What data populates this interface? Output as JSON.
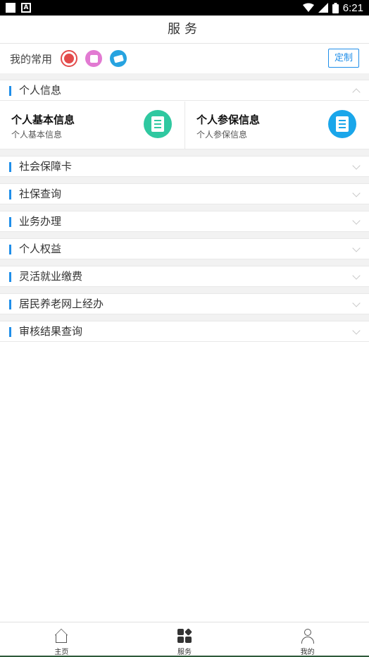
{
  "status_bar": {
    "time": "6:21",
    "a_icon": "A"
  },
  "header": {
    "title": "服务"
  },
  "favorites": {
    "label": "我的常用",
    "icons": [
      "social-security-logo-icon",
      "document-image-icon",
      "card-icon"
    ],
    "customize_label": "定制"
  },
  "personal_info": {
    "title": "个人信息",
    "cards": [
      {
        "title": "个人基本信息",
        "subtitle": "个人基本信息",
        "icon": "id-document-icon"
      },
      {
        "title": "个人参保信息",
        "subtitle": "个人参保信息",
        "icon": "insurance-document-icon"
      }
    ]
  },
  "sections": [
    {
      "label": "社会保障卡"
    },
    {
      "label": "社保查询"
    },
    {
      "label": "业务办理"
    },
    {
      "label": "个人权益"
    },
    {
      "label": "灵活就业缴费"
    },
    {
      "label": "居民养老网上经办"
    },
    {
      "label": "审核结果查询"
    }
  ],
  "tabs": [
    {
      "label": "主页",
      "icon": "home-icon"
    },
    {
      "label": "服务",
      "icon": "grid-icon"
    },
    {
      "label": "我的",
      "icon": "person-icon"
    }
  ],
  "colors": {
    "accent": "#1f8ee9",
    "green_icon": "#2fc8a0",
    "blue_icon": "#1aa6ea"
  }
}
